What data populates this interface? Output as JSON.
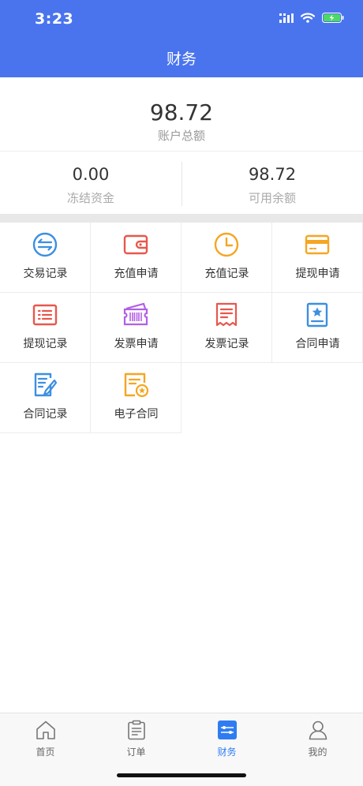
{
  "status": {
    "time": "3:23"
  },
  "nav": {
    "title": "财务"
  },
  "balance": {
    "total_amount": "98.72",
    "total_label": "账户总额"
  },
  "sub_balances": [
    {
      "amount": "0.00",
      "label": "冻结资金"
    },
    {
      "amount": "98.72",
      "label": "可用余额"
    }
  ],
  "menu": [
    {
      "label": "交易记录",
      "icon": "exchange-icon",
      "color": "#3d8fe0"
    },
    {
      "label": "充值申请",
      "icon": "wallet-icon",
      "color": "#e8574d"
    },
    {
      "label": "充值记录",
      "icon": "clock-icon",
      "color": "#f5a623"
    },
    {
      "label": "提现申请",
      "icon": "card-icon",
      "color": "#f5a623"
    },
    {
      "label": "提现记录",
      "icon": "list-icon",
      "color": "#e8574d"
    },
    {
      "label": "发票申请",
      "icon": "ticket-icon",
      "color": "#b25fe6"
    },
    {
      "label": "发票记录",
      "icon": "receipt-icon",
      "color": "#e8574d"
    },
    {
      "label": "合同申请",
      "icon": "contract-star-icon",
      "color": "#3d8fe0"
    },
    {
      "label": "合同记录",
      "icon": "document-edit-icon",
      "color": "#3d8fe0"
    },
    {
      "label": "电子合同",
      "icon": "certificate-icon",
      "color": "#f5a623"
    }
  ],
  "tabs": [
    {
      "label": "首页",
      "icon": "home-icon"
    },
    {
      "label": "订单",
      "icon": "clipboard-icon"
    },
    {
      "label": "财务",
      "icon": "finance-icon",
      "active": true
    },
    {
      "label": "我的",
      "icon": "user-icon"
    }
  ],
  "colors": {
    "header": "#4a74ee",
    "active_tab": "#2f7cf2"
  }
}
